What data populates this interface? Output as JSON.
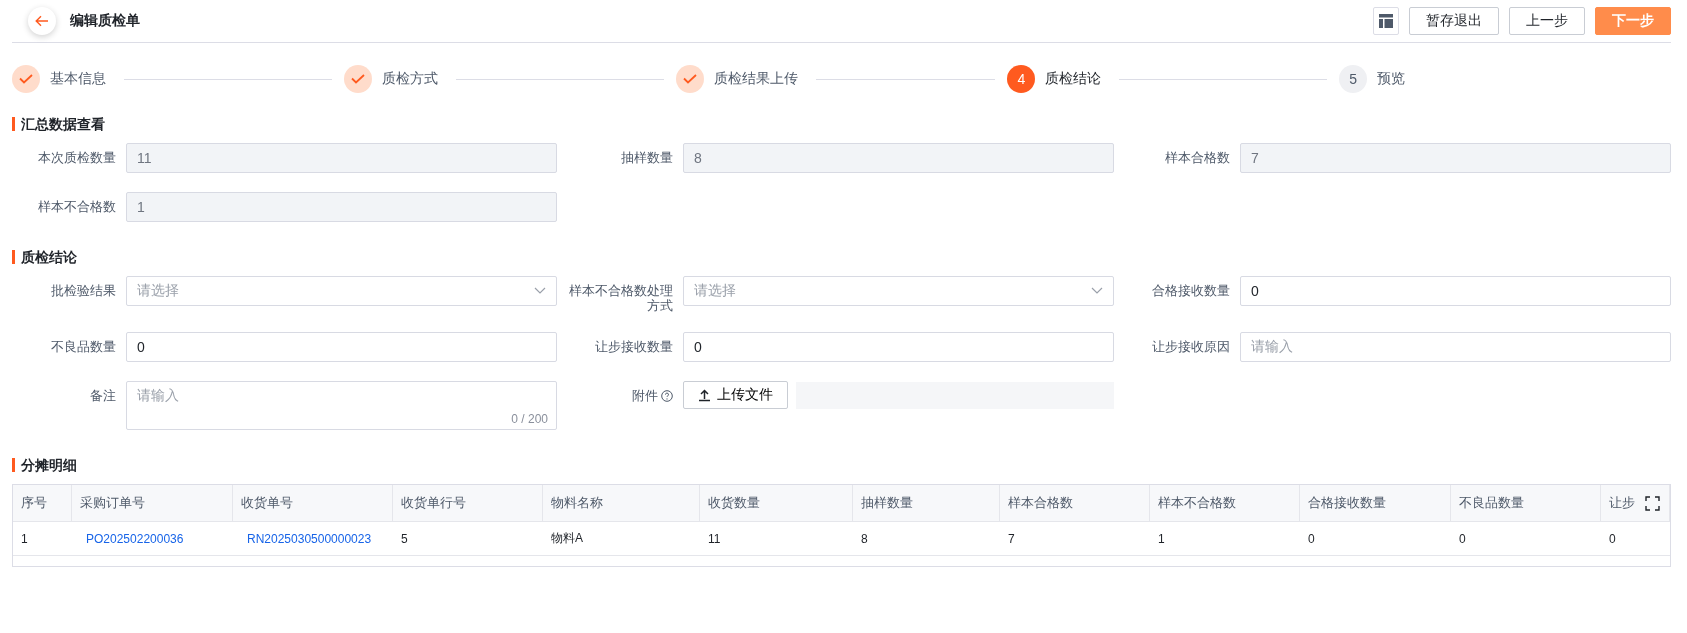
{
  "header": {
    "title": "编辑质检单",
    "buttons": [
      {
        "label": "暂存退出",
        "kind": "default"
      },
      {
        "label": "上一步",
        "kind": "default"
      },
      {
        "label": "下一步",
        "kind": "primary"
      }
    ]
  },
  "steps": [
    {
      "label": "基本信息",
      "completed": true,
      "selected": false
    },
    {
      "label": "质检方式",
      "completed": true,
      "selected": false
    },
    {
      "label": "质检结果上传",
      "completed": true,
      "selected": false
    },
    {
      "number": "4",
      "label": "质检结论",
      "completed": false,
      "selected": true
    },
    {
      "number": "5",
      "label": "预览",
      "completed": false,
      "selected": false
    }
  ],
  "summary": {
    "title": "汇总数据查看",
    "fields": [
      {
        "label": "本次质检数量",
        "kind": "readonly",
        "value": "11"
      },
      {
        "label": "抽样数量",
        "kind": "readonly",
        "value": "8"
      },
      {
        "label": "样本合格数",
        "kind": "readonly",
        "value": "7"
      },
      {
        "label": "样本不合格数",
        "kind": "readonly",
        "value": "1"
      }
    ]
  },
  "conclusion": {
    "title": "质检结论",
    "fields": [
      {
        "label": "批检验结果",
        "kind": "select",
        "placeholder": "请选择"
      },
      {
        "label": "样本不合格数处理方式",
        "kind": "select",
        "placeholder": "请选择"
      },
      {
        "label": "合格接收数量",
        "kind": "input",
        "value": "0"
      },
      {
        "label": "不良品数量",
        "kind": "input",
        "value": "0"
      },
      {
        "label": "让步接收数量",
        "kind": "input",
        "value": "0"
      },
      {
        "label": "让步接收原因",
        "kind": "input",
        "placeholder": "请输入"
      },
      {
        "label": "备注",
        "kind": "textarea",
        "placeholder": "请输入",
        "counter": "0 / 200"
      },
      {
        "label": "附件",
        "kind": "upload",
        "button": "上传文件"
      }
    ]
  },
  "allocation": {
    "title": "分摊明细",
    "columns": [
      "序号",
      "采购订单号",
      "收货单号",
      "收货单行号",
      "物料名称",
      "收货数量",
      "抽样数量",
      "样本合格数",
      "样本不合格数",
      "合格接收数量",
      "不良品数量",
      "让步"
    ],
    "rows": [
      [
        {
          "text": "1",
          "kind": "text"
        },
        {
          "text": "PO202502200036",
          "kind": "link"
        },
        {
          "text": "RN2025030500000023",
          "kind": "link"
        },
        {
          "text": "5",
          "kind": "text"
        },
        {
          "text": "物料A",
          "kind": "text"
        },
        {
          "text": "11",
          "kind": "text"
        },
        {
          "text": "8",
          "kind": "text"
        },
        {
          "text": "7",
          "kind": "text"
        },
        {
          "text": "1",
          "kind": "text"
        },
        {
          "text": "0",
          "kind": "text"
        },
        {
          "text": "0",
          "kind": "text"
        },
        {
          "text": "0",
          "kind": "text"
        }
      ]
    ]
  }
}
